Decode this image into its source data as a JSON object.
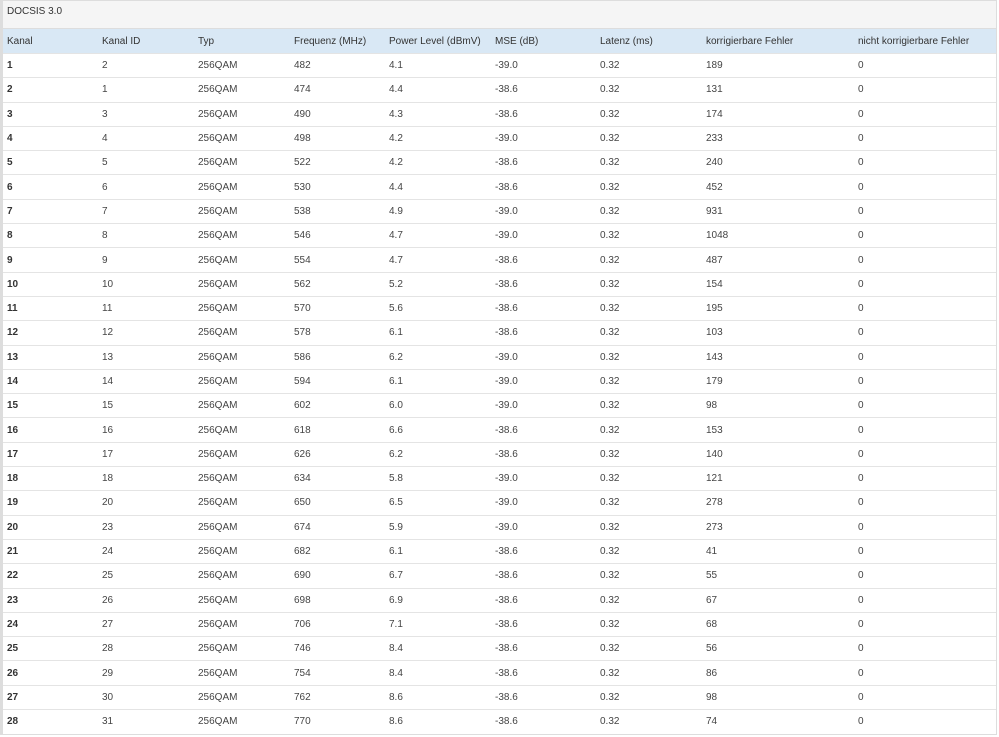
{
  "panel": {
    "title": "DOCSIS 3.0"
  },
  "table": {
    "headers": [
      "Kanal",
      "Kanal ID",
      "Typ",
      "Frequenz (MHz)",
      "Power Level (dBmV)",
      "MSE (dB)",
      "Latenz (ms)",
      "korrigierbare Fehler",
      "nicht korrigierbare Fehler"
    ],
    "rows": [
      [
        "1",
        "2",
        "256QAM",
        "482",
        "4.1",
        "-39.0",
        "0.32",
        "189",
        "0"
      ],
      [
        "2",
        "1",
        "256QAM",
        "474",
        "4.4",
        "-38.6",
        "0.32",
        "131",
        "0"
      ],
      [
        "3",
        "3",
        "256QAM",
        "490",
        "4.3",
        "-38.6",
        "0.32",
        "174",
        "0"
      ],
      [
        "4",
        "4",
        "256QAM",
        "498",
        "4.2",
        "-39.0",
        "0.32",
        "233",
        "0"
      ],
      [
        "5",
        "5",
        "256QAM",
        "522",
        "4.2",
        "-38.6",
        "0.32",
        "240",
        "0"
      ],
      [
        "6",
        "6",
        "256QAM",
        "530",
        "4.4",
        "-38.6",
        "0.32",
        "452",
        "0"
      ],
      [
        "7",
        "7",
        "256QAM",
        "538",
        "4.9",
        "-39.0",
        "0.32",
        "931",
        "0"
      ],
      [
        "8",
        "8",
        "256QAM",
        "546",
        "4.7",
        "-39.0",
        "0.32",
        "1048",
        "0"
      ],
      [
        "9",
        "9",
        "256QAM",
        "554",
        "4.7",
        "-38.6",
        "0.32",
        "487",
        "0"
      ],
      [
        "10",
        "10",
        "256QAM",
        "562",
        "5.2",
        "-38.6",
        "0.32",
        "154",
        "0"
      ],
      [
        "11",
        "11",
        "256QAM",
        "570",
        "5.6",
        "-38.6",
        "0.32",
        "195",
        "0"
      ],
      [
        "12",
        "12",
        "256QAM",
        "578",
        "6.1",
        "-38.6",
        "0.32",
        "103",
        "0"
      ],
      [
        "13",
        "13",
        "256QAM",
        "586",
        "6.2",
        "-39.0",
        "0.32",
        "143",
        "0"
      ],
      [
        "14",
        "14",
        "256QAM",
        "594",
        "6.1",
        "-39.0",
        "0.32",
        "179",
        "0"
      ],
      [
        "15",
        "15",
        "256QAM",
        "602",
        "6.0",
        "-39.0",
        "0.32",
        "98",
        "0"
      ],
      [
        "16",
        "16",
        "256QAM",
        "618",
        "6.6",
        "-38.6",
        "0.32",
        "153",
        "0"
      ],
      [
        "17",
        "17",
        "256QAM",
        "626",
        "6.2",
        "-38.6",
        "0.32",
        "140",
        "0"
      ],
      [
        "18",
        "18",
        "256QAM",
        "634",
        "5.8",
        "-39.0",
        "0.32",
        "121",
        "0"
      ],
      [
        "19",
        "20",
        "256QAM",
        "650",
        "6.5",
        "-39.0",
        "0.32",
        "278",
        "0"
      ],
      [
        "20",
        "23",
        "256QAM",
        "674",
        "5.9",
        "-39.0",
        "0.32",
        "273",
        "0"
      ],
      [
        "21",
        "24",
        "256QAM",
        "682",
        "6.1",
        "-38.6",
        "0.32",
        "41",
        "0"
      ],
      [
        "22",
        "25",
        "256QAM",
        "690",
        "6.7",
        "-38.6",
        "0.32",
        "55",
        "0"
      ],
      [
        "23",
        "26",
        "256QAM",
        "698",
        "6.9",
        "-38.6",
        "0.32",
        "67",
        "0"
      ],
      [
        "24",
        "27",
        "256QAM",
        "706",
        "7.1",
        "-38.6",
        "0.32",
        "68",
        "0"
      ],
      [
        "25",
        "28",
        "256QAM",
        "746",
        "8.4",
        "-38.6",
        "0.32",
        "56",
        "0"
      ],
      [
        "26",
        "29",
        "256QAM",
        "754",
        "8.4",
        "-38.6",
        "0.32",
        "86",
        "0"
      ],
      [
        "27",
        "30",
        "256QAM",
        "762",
        "8.6",
        "-38.6",
        "0.32",
        "98",
        "0"
      ],
      [
        "28",
        "31",
        "256QAM",
        "770",
        "8.6",
        "-38.6",
        "0.32",
        "74",
        "0"
      ]
    ]
  }
}
